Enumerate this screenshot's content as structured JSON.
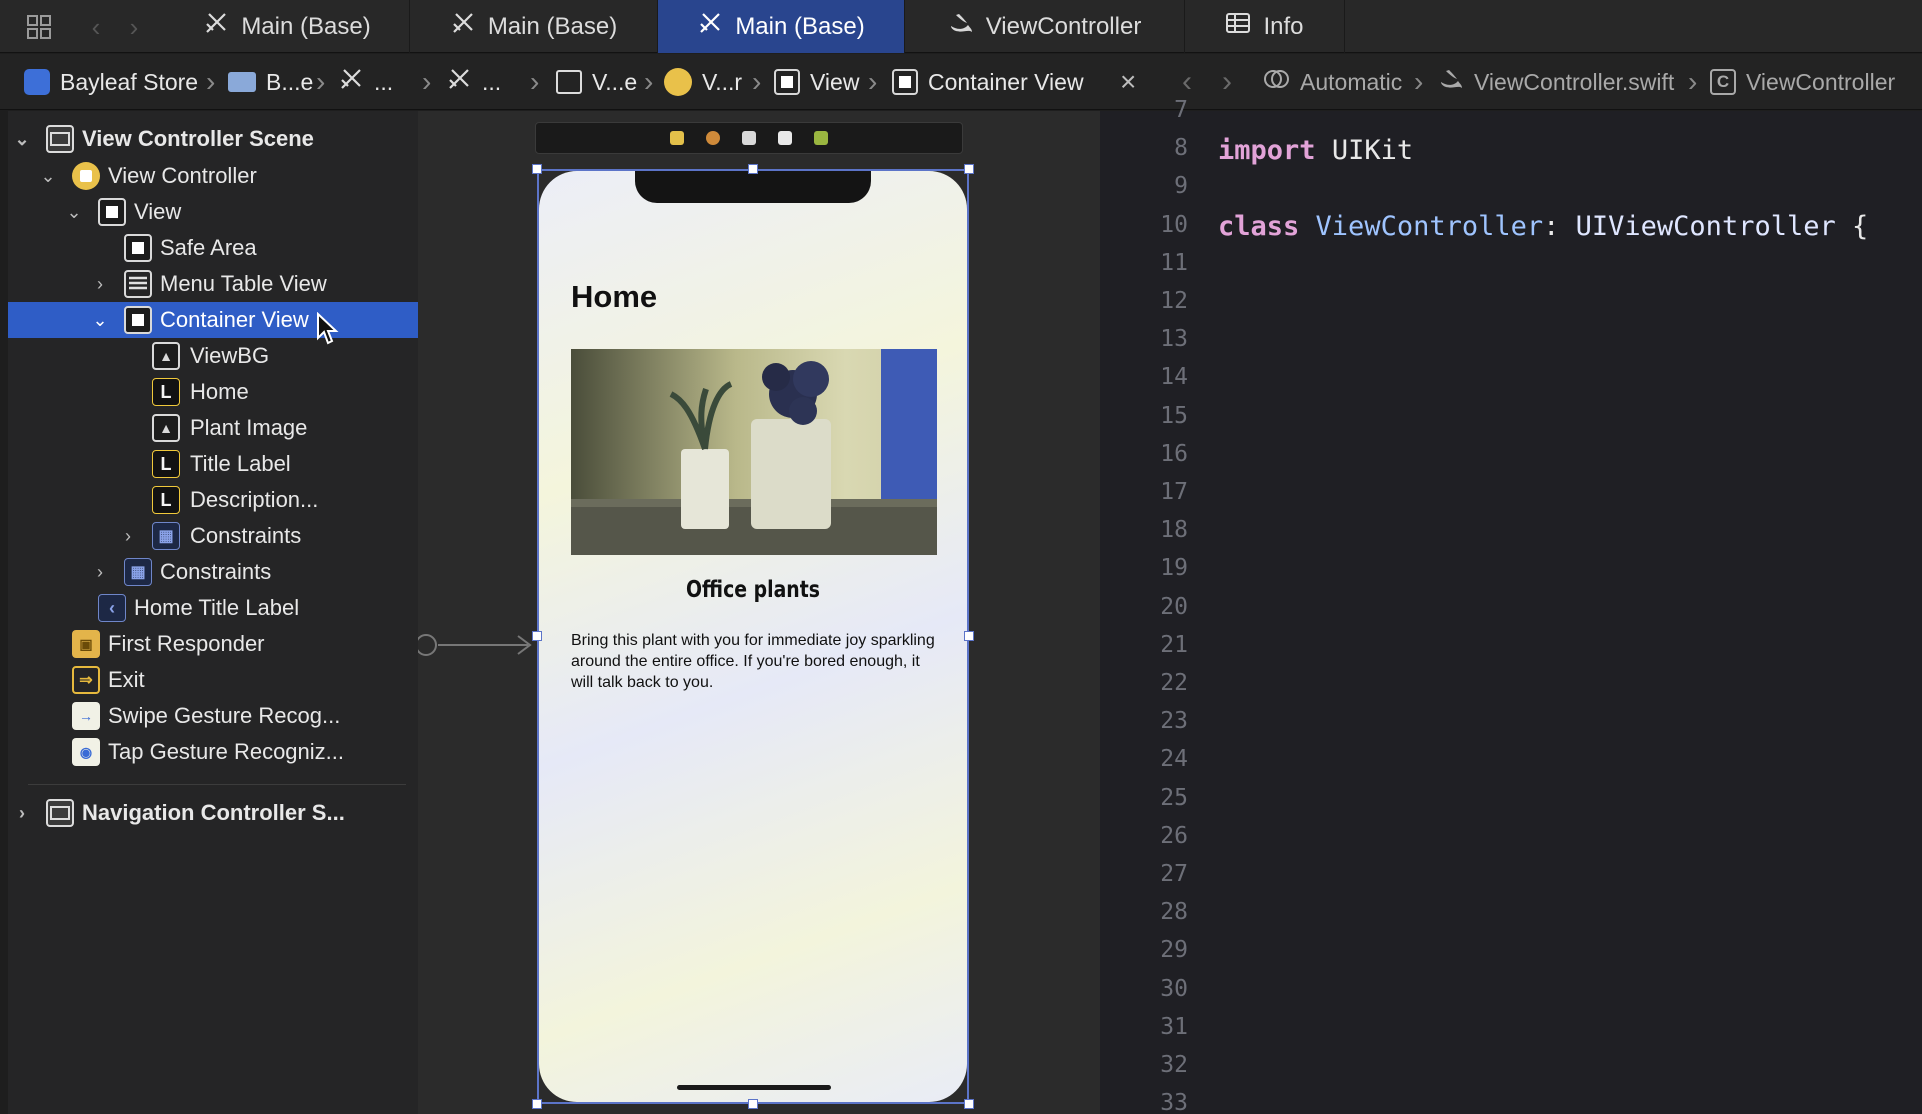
{
  "tabbar": {
    "tabs": [
      {
        "label": "Main (Base)",
        "icon": "storyboard-icon",
        "active": false
      },
      {
        "label": "Main (Base)",
        "icon": "storyboard-icon",
        "active": false
      },
      {
        "label": "Main (Base)",
        "icon": "storyboard-icon",
        "active": true
      },
      {
        "label": "ViewController",
        "icon": "swift-icon",
        "active": false
      },
      {
        "label": "Info",
        "icon": "table-icon",
        "active": false
      }
    ]
  },
  "jumpbar": {
    "left": [
      "Bayleaf Store",
      "B...e",
      "...",
      "...",
      "V...e",
      "V...r",
      "View",
      "Container View"
    ],
    "right": [
      "Automatic",
      "ViewController.swift",
      "ViewController"
    ]
  },
  "navigator": {
    "items": [
      {
        "label": "View Controller Scene",
        "icon": "scene-icon"
      },
      {
        "label": "View Controller",
        "icon": "view-controller-icon"
      },
      {
        "label": "View",
        "icon": "view-icon"
      },
      {
        "label": "Safe Area",
        "icon": "safe-area-icon"
      },
      {
        "label": "Menu Table View",
        "icon": "table-view-icon"
      },
      {
        "label": "Container View",
        "icon": "view-icon",
        "selected": true
      },
      {
        "label": "ViewBG",
        "icon": "image-view-icon"
      },
      {
        "label": "Home",
        "icon": "label-icon"
      },
      {
        "label": "Plant Image",
        "icon": "image-view-icon"
      },
      {
        "label": "Title Label",
        "icon": "label-icon"
      },
      {
        "label": "Description...",
        "icon": "label-icon"
      },
      {
        "label": "Constraints",
        "icon": "constraints-icon"
      },
      {
        "label": "Constraints",
        "icon": "constraints-icon"
      },
      {
        "label": "Home Title Label",
        "icon": "back-icon"
      },
      {
        "label": "First Responder",
        "icon": "first-responder-icon"
      },
      {
        "label": "Exit",
        "icon": "exit-icon"
      },
      {
        "label": "Swipe Gesture Recog...",
        "icon": "swipe-gesture-icon"
      },
      {
        "label": "Tap Gesture Recogniz...",
        "icon": "tap-gesture-icon"
      },
      {
        "label": "Navigation Controller S...",
        "icon": "scene-icon"
      }
    ],
    "glyphs": {
      "label_letter": "L",
      "back_glyph": "‹"
    }
  },
  "canvas": {
    "home_heading": "Home",
    "plant_title": "Office plants",
    "description": "Bring this plant with you for immediate joy sparkling around the entire office. If you're bored enough, it will talk back to you."
  },
  "editor": {
    "lines": [
      {
        "num": "7",
        "kind": "blank"
      },
      {
        "num": "8",
        "kind": "import",
        "kw": "import",
        "rest": "UIKit"
      },
      {
        "num": "9",
        "kind": "blank"
      },
      {
        "num": "10",
        "kind": "class",
        "kw": "class",
        "name": "ViewController",
        "sep": ": ",
        "super": "UIViewController",
        "brace": " {"
      },
      {
        "num": "11"
      },
      {
        "num": "12"
      },
      {
        "num": "13"
      },
      {
        "num": "14"
      },
      {
        "num": "15"
      },
      {
        "num": "16"
      },
      {
        "num": "17"
      },
      {
        "num": "18"
      },
      {
        "num": "19"
      },
      {
        "num": "20"
      },
      {
        "num": "21"
      },
      {
        "num": "22"
      },
      {
        "num": "23"
      },
      {
        "num": "24"
      },
      {
        "num": "25"
      },
      {
        "num": "26"
      },
      {
        "num": "27"
      },
      {
        "num": "28"
      },
      {
        "num": "29"
      },
      {
        "num": "30"
      },
      {
        "num": "31"
      },
      {
        "num": "32"
      },
      {
        "num": "33"
      }
    ]
  },
  "colors": {
    "accent": "#2f5dc6",
    "active_tab": "#29458e",
    "keyword": "#e2a3d8",
    "type": "#9fc4ff"
  }
}
